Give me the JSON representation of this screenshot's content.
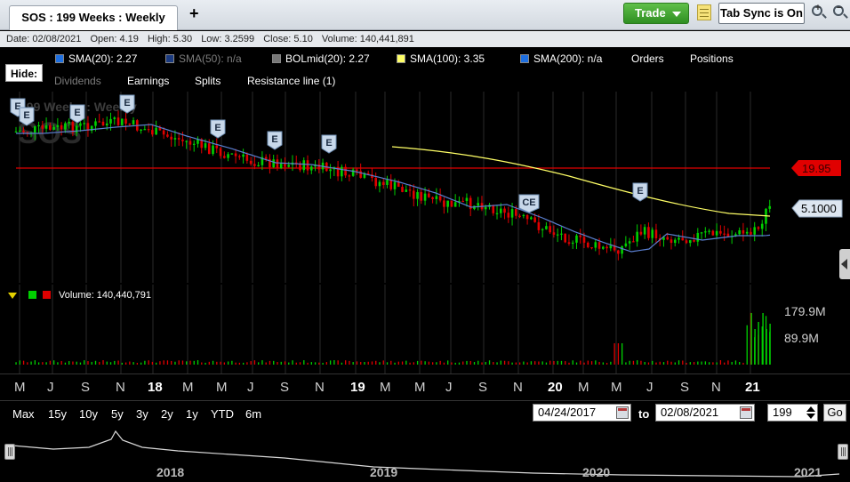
{
  "tab": {
    "title": "SOS : 199  Weeks : Weekly",
    "add_label": "+"
  },
  "toolbar": {
    "trade_label": "Trade",
    "tab_sync_label": "Tab Sync is On",
    "zoom_in": "+",
    "zoom_out": "−"
  },
  "info": {
    "date": "Date: 02/08/2021",
    "open": "Open: 4.19",
    "high": "High: 5.30",
    "low": "Low: 3.2599",
    "close": "Close: 5.10",
    "volume": "Volume: 140,441,891"
  },
  "legend": {
    "hide_label": "Hide:",
    "items": [
      {
        "label": "SMA(20): 2.27",
        "color": "#1e6fe0"
      },
      {
        "label": "SMA(50): n/a",
        "color": "#1a3a80"
      },
      {
        "label": "BOLmid(20): 2.27",
        "color": "#777777"
      },
      {
        "label": "SMA(100): 3.35",
        "color": "#ffff66"
      },
      {
        "label": "SMA(200): n/a",
        "color": "#1e6fe0"
      }
    ],
    "orders": "Orders",
    "positions": "Positions",
    "dividends": "Dividends",
    "earnings": "Earnings",
    "splits": "Splits",
    "resistance": "Resistance line (1)"
  },
  "watermark": {
    "title": "199  Weeks : Weekly",
    "symbol": "SOS"
  },
  "markers": {
    "earnings": "E",
    "ce": "CE"
  },
  "price_axis": {
    "resistance_label": "19.95",
    "last_label": "5.1000"
  },
  "volume": {
    "label": "Volume: 140,440,791",
    "tick_high": "179.9M",
    "tick_mid": "89.9M"
  },
  "x_axis": {
    "ticks": [
      {
        "t": "M",
        "year": false
      },
      {
        "t": "J",
        "year": false
      },
      {
        "t": "S",
        "year": false
      },
      {
        "t": "N",
        "year": false
      },
      {
        "t": "18",
        "year": true
      },
      {
        "t": "M",
        "year": false
      },
      {
        "t": "M",
        "year": false
      },
      {
        "t": "J",
        "year": false
      },
      {
        "t": "S",
        "year": false
      },
      {
        "t": "N",
        "year": false
      },
      {
        "t": "19",
        "year": true
      },
      {
        "t": "M",
        "year": false
      },
      {
        "t": "M",
        "year": false
      },
      {
        "t": "J",
        "year": false
      },
      {
        "t": "S",
        "year": false
      },
      {
        "t": "N",
        "year": false
      },
      {
        "t": "20",
        "year": true
      },
      {
        "t": "M",
        "year": false
      },
      {
        "t": "M",
        "year": false
      },
      {
        "t": "J",
        "year": false
      },
      {
        "t": "S",
        "year": false
      },
      {
        "t": "N",
        "year": false
      },
      {
        "t": "21",
        "year": true
      }
    ]
  },
  "range": {
    "buttons": [
      "Max",
      "15y",
      "10y",
      "5y",
      "3y",
      "2y",
      "1y",
      "YTD",
      "6m"
    ],
    "from_date": "04/24/2017",
    "to_label": "to",
    "to_date": "02/08/2021",
    "bars": "199",
    "go_label": "Go"
  },
  "navigator": {
    "years": [
      "2018",
      "2019",
      "2020",
      "2021"
    ]
  },
  "colors": {
    "up": "#00d000",
    "down": "#e00000",
    "resistance": "#e00000",
    "sma100": "#ffff66",
    "sma20": "#5a7fd0",
    "trade": "#3a9f2c"
  }
}
